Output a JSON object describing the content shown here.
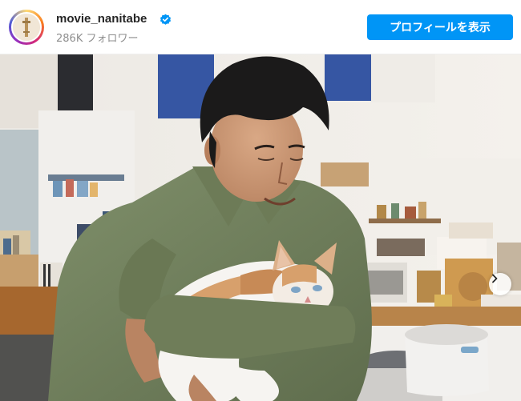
{
  "profile": {
    "username": "movie_nanitabe",
    "followers": "286K フォロワー",
    "verified": true
  },
  "actions": {
    "view_profile_label": "プロフィールを表示"
  },
  "post": {
    "photo_subject": "man-holding-calico-cat-in-kitchen",
    "carousel_next_icon": "chevron-right-icon"
  },
  "colors": {
    "accent": "#0095f6",
    "username": "#262626",
    "secondary_text": "#8e8e8e",
    "verified_badge": "#0095f6"
  }
}
